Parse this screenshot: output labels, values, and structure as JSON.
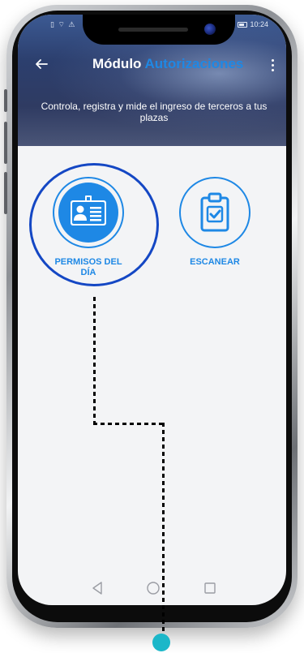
{
  "status_bar": {
    "left_icons": "▯ ⌔ ⚠",
    "time": "10:24"
  },
  "app_bar": {
    "title_prefix": "Módulo",
    "title_highlight": "Autorizaciones"
  },
  "header": {
    "subtitle": "Controla, registra y mide el ingreso de terceros a tus plazas"
  },
  "tiles": [
    {
      "label": "PERMISOS DEL DÍA",
      "icon": "id-card-icon"
    },
    {
      "label": "ESCANEAR",
      "icon": "clipboard-check-icon"
    }
  ],
  "colors": {
    "accent": "#1e88e5",
    "highlight": "#1447c4",
    "pointer": "#1bb7c9"
  }
}
